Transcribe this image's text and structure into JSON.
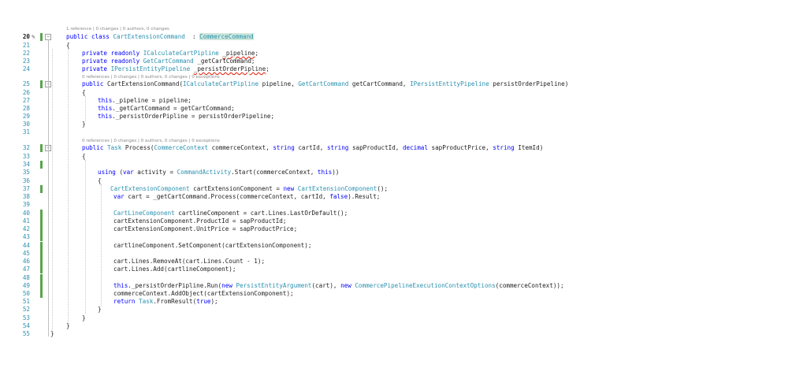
{
  "lens": {
    "class_ref": "1 reference | 0 changes | 0 authors, 0 changes",
    "ctor_ref": "0 references | 0 changes | 0 authors, 0 changes | 0 exceptions",
    "process_ref": "0 references | 0 changes | 0 authors, 0 changes | 0 exceptions"
  },
  "lines": [
    {
      "n": "20",
      "segs": [
        [
          "k",
          "public class "
        ],
        [
          "t",
          "CartExtensionCommand"
        ],
        [
          "",
          "  : "
        ],
        [
          "t hl",
          "CommerceCommand"
        ]
      ]
    },
    {
      "n": "21",
      "segs": [
        [
          "",
          "{"
        ]
      ]
    },
    {
      "n": "22",
      "segs": [
        [
          "k",
          "private readonly "
        ],
        [
          "t",
          "ICalculateCartPipline"
        ],
        [
          "",
          " "
        ],
        [
          "sqg",
          "_pipeline"
        ],
        [
          "",
          ";"
        ]
      ]
    },
    {
      "n": "23",
      "segs": [
        [
          "k",
          "private readonly "
        ],
        [
          "t",
          "GetCartCommand"
        ],
        [
          "",
          " _getCartCommand;"
        ]
      ]
    },
    {
      "n": "24",
      "segs": [
        [
          "k",
          "private "
        ],
        [
          "t",
          "IPersistEntityPipeline"
        ],
        [
          "",
          " "
        ],
        [
          "sqg",
          "_persistOrderPipline"
        ],
        [
          "",
          ";"
        ]
      ]
    },
    {
      "n": "25",
      "segs": [
        [
          "k",
          "public "
        ],
        [
          "",
          "CartExtensionCommand("
        ],
        [
          "t",
          "ICalculateCartPipline"
        ],
        [
          "",
          " pipeline, "
        ],
        [
          "t",
          "GetCartCommand"
        ],
        [
          "",
          " getCartCommand, "
        ],
        [
          "t",
          "IPersistEntityPipeline"
        ],
        [
          "",
          " persistOrderPipeline)"
        ]
      ]
    },
    {
      "n": "26",
      "segs": [
        [
          "",
          "{"
        ]
      ]
    },
    {
      "n": "27",
      "segs": [
        [
          "k",
          "this"
        ],
        [
          "",
          "._pipeline = pipeline;"
        ]
      ]
    },
    {
      "n": "28",
      "segs": [
        [
          "k",
          "this"
        ],
        [
          "",
          "._getCartCommand = getCartCommand;"
        ]
      ]
    },
    {
      "n": "29",
      "segs": [
        [
          "k",
          "this"
        ],
        [
          "",
          "._persistOrderPipline = persistOrderPipeline;"
        ]
      ]
    },
    {
      "n": "30",
      "segs": [
        [
          "",
          "}"
        ]
      ]
    },
    {
      "n": "31",
      "segs": []
    },
    {
      "n": "32",
      "segs": [
        [
          "k",
          "public "
        ],
        [
          "t",
          "Task"
        ],
        [
          "",
          " Process("
        ],
        [
          "t",
          "CommerceContext"
        ],
        [
          "",
          " commerceContext, "
        ],
        [
          "k",
          "string"
        ],
        [
          "",
          " cartId, "
        ],
        [
          "k",
          "string"
        ],
        [
          "",
          " sapProductId, "
        ],
        [
          "k",
          "decimal"
        ],
        [
          "",
          " sapProductPrice, "
        ],
        [
          "k",
          "string"
        ],
        [
          "",
          " ItemId)"
        ]
      ]
    },
    {
      "n": "33",
      "segs": [
        [
          "",
          "{"
        ]
      ]
    },
    {
      "n": "34",
      "segs": []
    },
    {
      "n": "35",
      "segs": [
        [
          "k",
          "using "
        ],
        [
          "",
          "("
        ],
        [
          "k",
          "var"
        ],
        [
          "",
          " activity = "
        ],
        [
          "t",
          "CommandActivity"
        ],
        [
          "",
          ".Start(commerceContext, "
        ],
        [
          "k",
          "this"
        ],
        [
          "",
          "))"
        ]
      ]
    },
    {
      "n": "36",
      "segs": [
        [
          "",
          "{"
        ]
      ]
    },
    {
      "n": "37",
      "segs": [
        [
          "t",
          "CartExtensionComponent"
        ],
        [
          "",
          " cartExtensionComponent = "
        ],
        [
          "k",
          "new "
        ],
        [
          "t",
          "CartExtensionComponent"
        ],
        [
          "",
          "();"
        ]
      ]
    },
    {
      "n": "38",
      "segs": [
        [
          "k",
          "var"
        ],
        [
          "",
          " cart = _getCartCommand.Process(commerceContext, cartId, "
        ],
        [
          "k",
          "false"
        ],
        [
          "",
          ").Result;"
        ]
      ]
    },
    {
      "n": "39",
      "segs": []
    },
    {
      "n": "40",
      "segs": [
        [
          "t",
          "CartLineComponent"
        ],
        [
          "",
          " cartlineComponent = cart.Lines.LastOrDefault();"
        ]
      ]
    },
    {
      "n": "41",
      "segs": [
        [
          "",
          "cartExtensionComponent.ProductId = sapProductId;"
        ]
      ]
    },
    {
      "n": "42",
      "segs": [
        [
          "",
          "cartExtensionComponent.UnitPrice = sapProductPrice;"
        ]
      ]
    },
    {
      "n": "43",
      "segs": []
    },
    {
      "n": "44",
      "segs": [
        [
          "",
          "cartlineComponent.SetComponent(cartExtensionComponent);"
        ]
      ]
    },
    {
      "n": "45",
      "segs": []
    },
    {
      "n": "46",
      "segs": [
        [
          "",
          "cart.Lines.RemoveAt(cart.Lines.Count - 1);"
        ]
      ]
    },
    {
      "n": "47",
      "segs": [
        [
          "",
          "cart.Lines.Add(cartlineComponent);"
        ]
      ]
    },
    {
      "n": "48",
      "segs": []
    },
    {
      "n": "49",
      "segs": [
        [
          "k",
          "this"
        ],
        [
          "",
          "._persistOrderPipline.Run("
        ],
        [
          "k",
          "new "
        ],
        [
          "t",
          "PersistEntityArgument"
        ],
        [
          "",
          "(cart), "
        ],
        [
          "k",
          "new "
        ],
        [
          "t",
          "CommercePipelineExecutionContextOptions"
        ],
        [
          "",
          "(commerceContext));"
        ]
      ]
    },
    {
      "n": "50",
      "segs": [
        [
          "",
          "commerceContext.AddObject(cartExtensionComponent);"
        ]
      ]
    },
    {
      "n": "51",
      "segs": [
        [
          "k",
          "return "
        ],
        [
          "t",
          "Task"
        ],
        [
          "",
          ".FromResult("
        ],
        [
          "k",
          "true"
        ],
        [
          "",
          ");"
        ]
      ]
    },
    {
      "n": "52",
      "segs": [
        [
          "",
          "}"
        ]
      ]
    },
    {
      "n": "53",
      "segs": [
        [
          "",
          "}"
        ]
      ]
    },
    {
      "n": "54",
      "segs": [
        [
          "",
          "}"
        ]
      ]
    },
    {
      "n": "55",
      "segs": [
        [
          "",
          "}"
        ]
      ]
    }
  ],
  "colors": {
    "keyword": "#0000ff",
    "type": "#2b91af",
    "line_number": "#2b91af",
    "change_marker": "#57a64a"
  },
  "icons": {
    "edit": "pencil-icon",
    "fold": "fold-toggle-icon"
  }
}
